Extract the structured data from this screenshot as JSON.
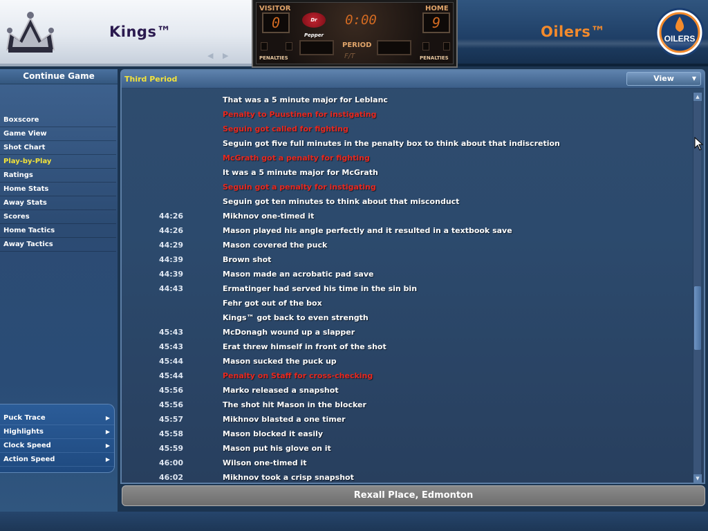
{
  "header": {
    "visitor_team": "Kings™",
    "home_team": "Oilers™",
    "kings_logo": "kings-crown-logo",
    "oilers_logo": "oilers-drop-logo",
    "oilers_logo_text": "OILERS"
  },
  "scoreboard": {
    "visitor_label": "VISITOR",
    "home_label": "HOME",
    "visitor_score": "0",
    "home_score": "9",
    "clock": "0:00",
    "sponsor": "Dr Pepper",
    "period_label": "PERIOD",
    "period_value": "F/T",
    "penalties_left": "PENALTIES",
    "penalties_right": "PENALTIES"
  },
  "sidebar": {
    "continue_label": "Continue Game",
    "nav": [
      {
        "label": "Boxscore",
        "active": false
      },
      {
        "label": "Game View",
        "active": false
      },
      {
        "label": "Shot Chart",
        "active": false
      },
      {
        "label": "Play-by-Play",
        "active": true
      },
      {
        "label": "Ratings",
        "active": false
      },
      {
        "label": "Home Stats",
        "active": false
      },
      {
        "label": "Away Stats",
        "active": false
      },
      {
        "label": "Scores",
        "active": false
      },
      {
        "label": "Home Tactics",
        "active": false
      },
      {
        "label": "Away Tactics",
        "active": false
      }
    ],
    "lower": [
      {
        "label": "Puck Trace"
      },
      {
        "label": "Highlights"
      },
      {
        "label": "Clock Speed"
      },
      {
        "label": "Action Speed"
      }
    ]
  },
  "main": {
    "period_title": "Third Period",
    "view_label": "View",
    "rows": [
      {
        "time": "",
        "text": "That was a 5 minute major for Leblanc",
        "penalty": false
      },
      {
        "time": "",
        "text": "Penalty to Puustinen for instigating",
        "penalty": true
      },
      {
        "time": "",
        "text": "Seguin got called for fighting",
        "penalty": true
      },
      {
        "time": "",
        "text": "Seguin got five full minutes in the penalty box to think about that indiscretion",
        "penalty": false
      },
      {
        "time": "",
        "text": "McGrath got a penalty for fighting",
        "penalty": true
      },
      {
        "time": "",
        "text": "It was a 5 minute major for McGrath",
        "penalty": false
      },
      {
        "time": "",
        "text": "Seguin got a penalty for instigating",
        "penalty": true
      },
      {
        "time": "",
        "text": "Seguin got ten minutes to think about that misconduct",
        "penalty": false
      },
      {
        "time": "44:26",
        "text": "Mikhnov one-timed it",
        "penalty": false
      },
      {
        "time": "44:26",
        "text": "Mason played his angle perfectly and it resulted in a textbook save",
        "penalty": false
      },
      {
        "time": "44:29",
        "text": "Mason covered the puck",
        "penalty": false
      },
      {
        "time": "44:39",
        "text": "Brown shot",
        "penalty": false
      },
      {
        "time": "44:39",
        "text": "Mason made an acrobatic pad save",
        "penalty": false
      },
      {
        "time": "44:43",
        "text": "Ermatinger had served his time in the sin bin",
        "penalty": false
      },
      {
        "time": "",
        "text": "Fehr got out of the box",
        "penalty": false
      },
      {
        "time": "",
        "text": "Kings™ got back to even strength",
        "penalty": false
      },
      {
        "time": "45:43",
        "text": "McDonagh wound up a slapper",
        "penalty": false
      },
      {
        "time": "45:43",
        "text": "Erat threw himself in front of the shot",
        "penalty": false
      },
      {
        "time": "45:44",
        "text": "Mason sucked the puck up",
        "penalty": false
      },
      {
        "time": "45:44",
        "text": "Penalty on Staff for cross-checking",
        "penalty": true
      },
      {
        "time": "45:56",
        "text": "Marko released a snapshot",
        "penalty": false
      },
      {
        "time": "45:56",
        "text": "The shot hit Mason in the blocker",
        "penalty": false
      },
      {
        "time": "45:57",
        "text": "Mikhnov blasted a one timer",
        "penalty": false
      },
      {
        "time": "45:58",
        "text": "Mason blocked it easily",
        "penalty": false
      },
      {
        "time": "45:59",
        "text": "Mason put his glove on it",
        "penalty": false
      },
      {
        "time": "46:00",
        "text": "Wilson one-timed it",
        "penalty": false
      },
      {
        "time": "46:02",
        "text": "Mikhnov took a crisp snapshot",
        "penalty": false
      }
    ]
  },
  "venue": "Rexall Place, Edmonton",
  "icons": {
    "scroll_up": "▲",
    "scroll_down": "▼",
    "dropdown": "▼",
    "submenu": "▶",
    "header_prev": "◀",
    "header_next": "▶"
  },
  "colors": {
    "active_nav": "#f4e33a",
    "penalty_text": "#e8281f",
    "scoreboard_digits": "#d26a22"
  }
}
